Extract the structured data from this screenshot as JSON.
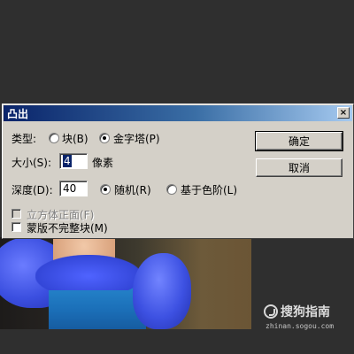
{
  "dialog": {
    "title": "凸出",
    "close_glyph": "×",
    "type_label": "类型:",
    "type_options": [
      {
        "label": "块(B)",
        "selected": false
      },
      {
        "label": "金字塔(P)",
        "selected": true
      }
    ],
    "size_label": "大小(S):",
    "size_value": "4",
    "size_unit": "像素",
    "depth_label": "深度(D):",
    "depth_value": "40",
    "depth_options": [
      {
        "label": "随机(R)",
        "selected": true
      },
      {
        "label": "基于色阶(L)",
        "selected": false
      }
    ],
    "solid_front_faces": {
      "label": "立方体正面(F)",
      "checked": false,
      "enabled": false
    },
    "mask_incomplete_blocks": {
      "label": "蒙版不完整块(M)",
      "checked": false,
      "enabled": true
    },
    "ok_label": "确定",
    "cancel_label": "取消"
  },
  "watermark": {
    "title": "搜狗指南",
    "url": "zhinan.sogou.com"
  },
  "colors": {
    "titlebar_start": "#0a246a",
    "titlebar_end": "#a6caf0",
    "dialog_face": "#d4d0c8",
    "app_background": "#2f2f2f"
  }
}
